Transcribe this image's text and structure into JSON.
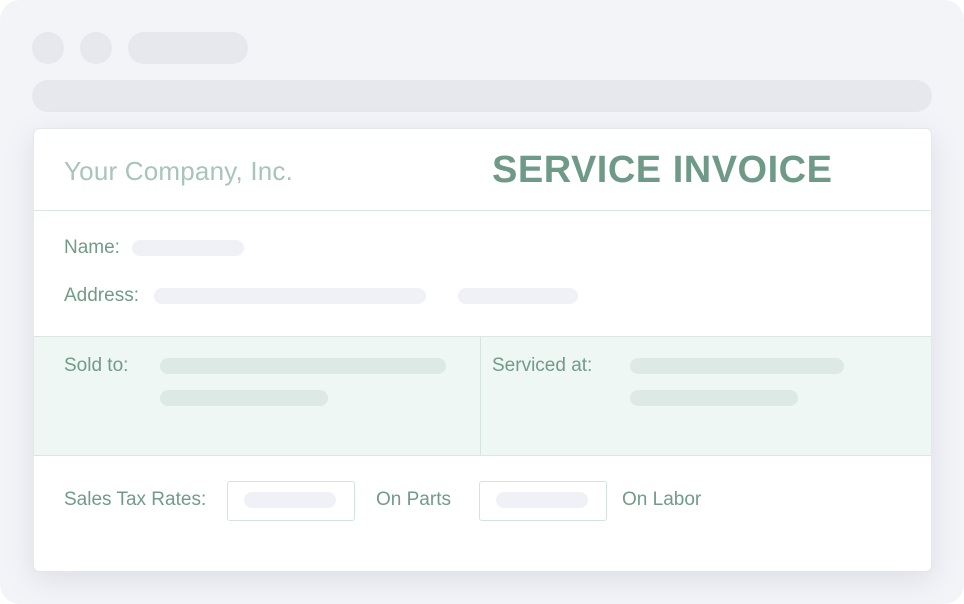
{
  "invoice": {
    "company_name": "Your Company, Inc.",
    "title": "SERVICE INVOICE",
    "fields": {
      "name_label": "Name:",
      "address_label": "Address:"
    },
    "parties": {
      "sold_to_label": "Sold to:",
      "serviced_at_label": "Serviced at:"
    },
    "tax": {
      "label": "Sales Tax Rates:",
      "parts_label": "On Parts",
      "labor_label": "On Labor"
    }
  },
  "colors": {
    "accent_green": "#6f9a87",
    "company_text": "#a9c4b8",
    "band_background": "#eef7f4",
    "placeholder": "#f0f1f6",
    "browser_chrome": "#f3f4f8"
  }
}
